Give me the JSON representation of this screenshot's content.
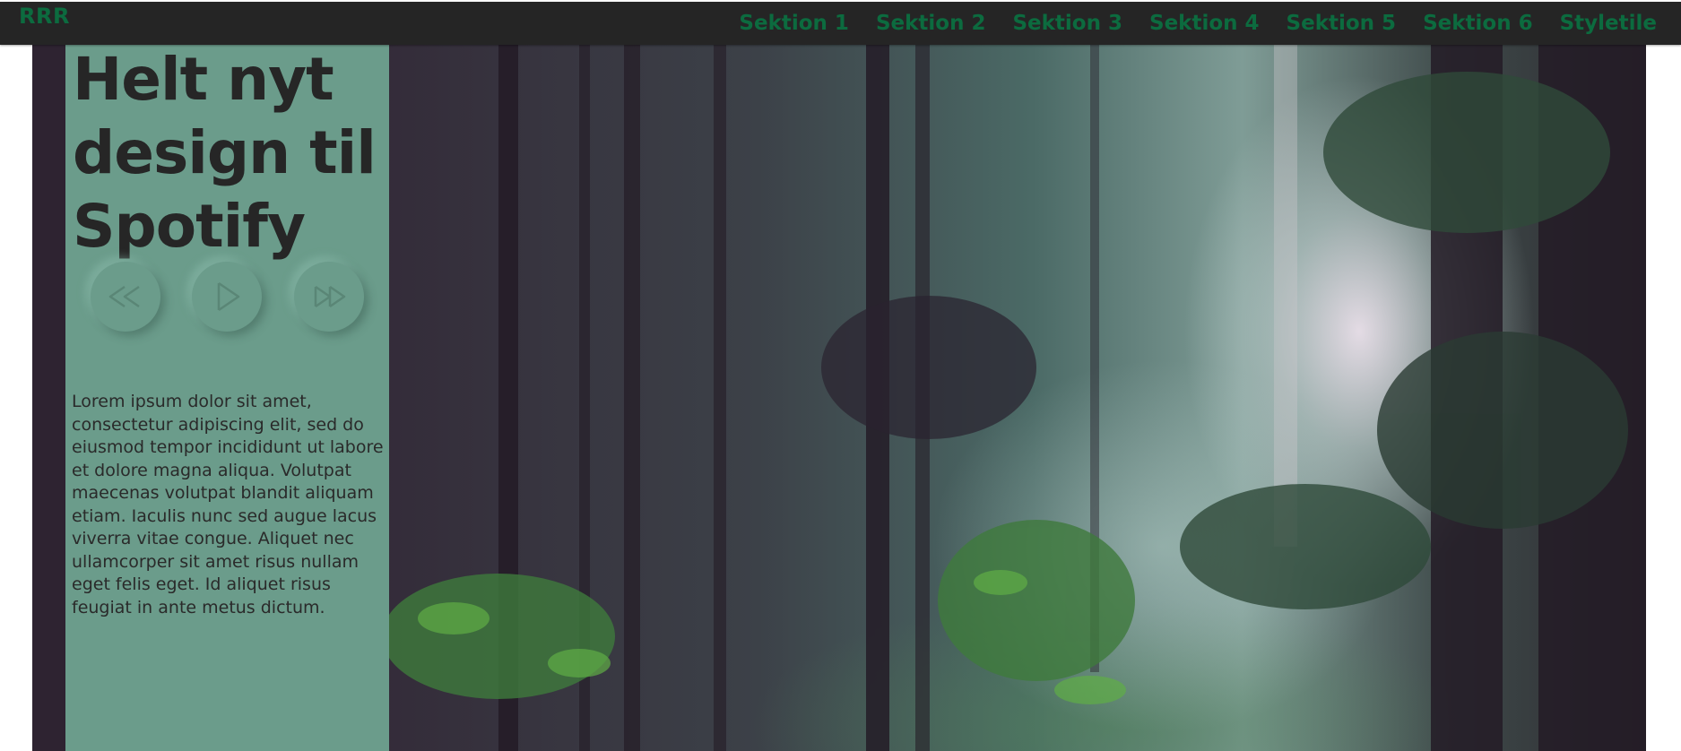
{
  "header": {
    "logo": "RRR",
    "nav_items": [
      {
        "label": "Sektion 1"
      },
      {
        "label": "Sektion 2"
      },
      {
        "label": "Sektion 3"
      },
      {
        "label": "Sektion 4"
      },
      {
        "label": "Sektion 5"
      },
      {
        "label": "Sektion 6"
      },
      {
        "label": "Styletile"
      }
    ]
  },
  "hero": {
    "headline": "Helt nyt design til Spotify",
    "controls": [
      {
        "icon": "rewind-icon"
      },
      {
        "icon": "play-icon"
      },
      {
        "icon": "fast-forward-icon"
      }
    ],
    "body": "Lorem ipsum dolor sit amet, consectetur adipiscing elit, sed do eiusmod tempor incididunt ut labore et dolore magna aliqua. Volutpat maecenas volutpat blandit aliquam etiam. Iaculis nunc sed augue lacus viverra vitae congue. Aliquet nec ullamcorper sit amet risus nullam eget felis eget. Id aliquet risus feugiat in ante metus dictum."
  },
  "colors": {
    "nav_bg": "#252525",
    "accent_green": "#0c6b3f",
    "panel_bg": "#6b9c8b",
    "text_dark": "#262626"
  }
}
